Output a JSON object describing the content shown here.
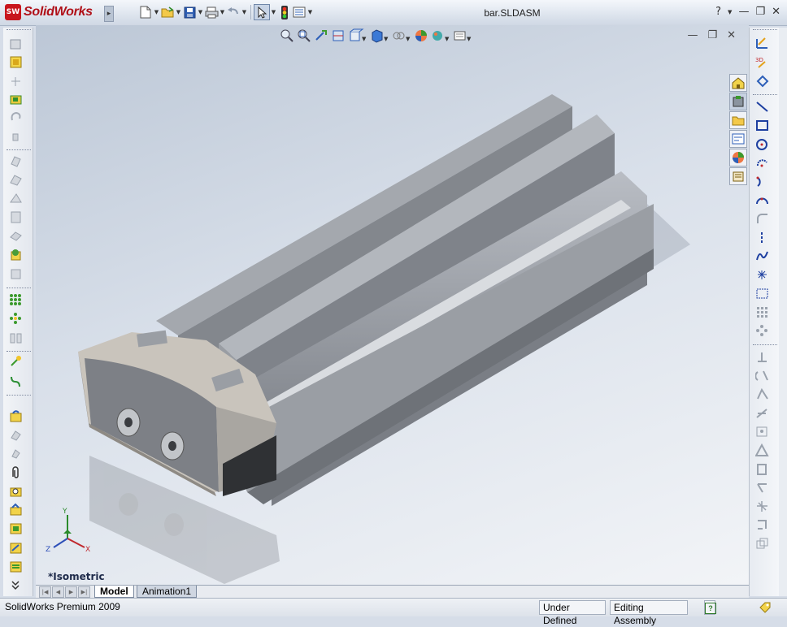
{
  "app": {
    "logo_badge": "SW",
    "logo_text": "SolidWorks",
    "document_title": "bar.SLDASM",
    "accent_color": "#c8161d"
  },
  "title_toolbar": {
    "icons": [
      "new-document-icon",
      "open-folder-icon",
      "save-icon",
      "print-icon",
      "undo-icon",
      "select-pointer-icon",
      "rebuild-traffic-light-icon",
      "options-icon"
    ]
  },
  "window_controls": {
    "help_label": "?",
    "minimize_label": "—",
    "restore_label": "❐",
    "close_label": "✕"
  },
  "heads_up_toolbar": {
    "icons": [
      "zoom-to-fit-icon",
      "zoom-to-area-icon",
      "previous-view-icon",
      "section-view-icon",
      "view-orientation-icon",
      "display-style-icon",
      "hide-show-items-icon",
      "edit-appearance-icon",
      "apply-scene-icon",
      "view-settings-icon"
    ]
  },
  "viewport": {
    "view_name": "*Isometric",
    "triad": {
      "x_label": "X",
      "y_label": "Y",
      "z_label": "Z"
    },
    "model_part_colors": {
      "body": "#8f9399",
      "end_cap": "#c9c4bc",
      "rail": "#a7abb1"
    }
  },
  "bottom_tabs": {
    "active": "Model",
    "inactive": "Animation1"
  },
  "status_bar": {
    "product": "SolidWorks Premium 2009",
    "status_defined": "Under Defined",
    "status_mode": "Editing Assembly",
    "help_icon_label": "?"
  }
}
